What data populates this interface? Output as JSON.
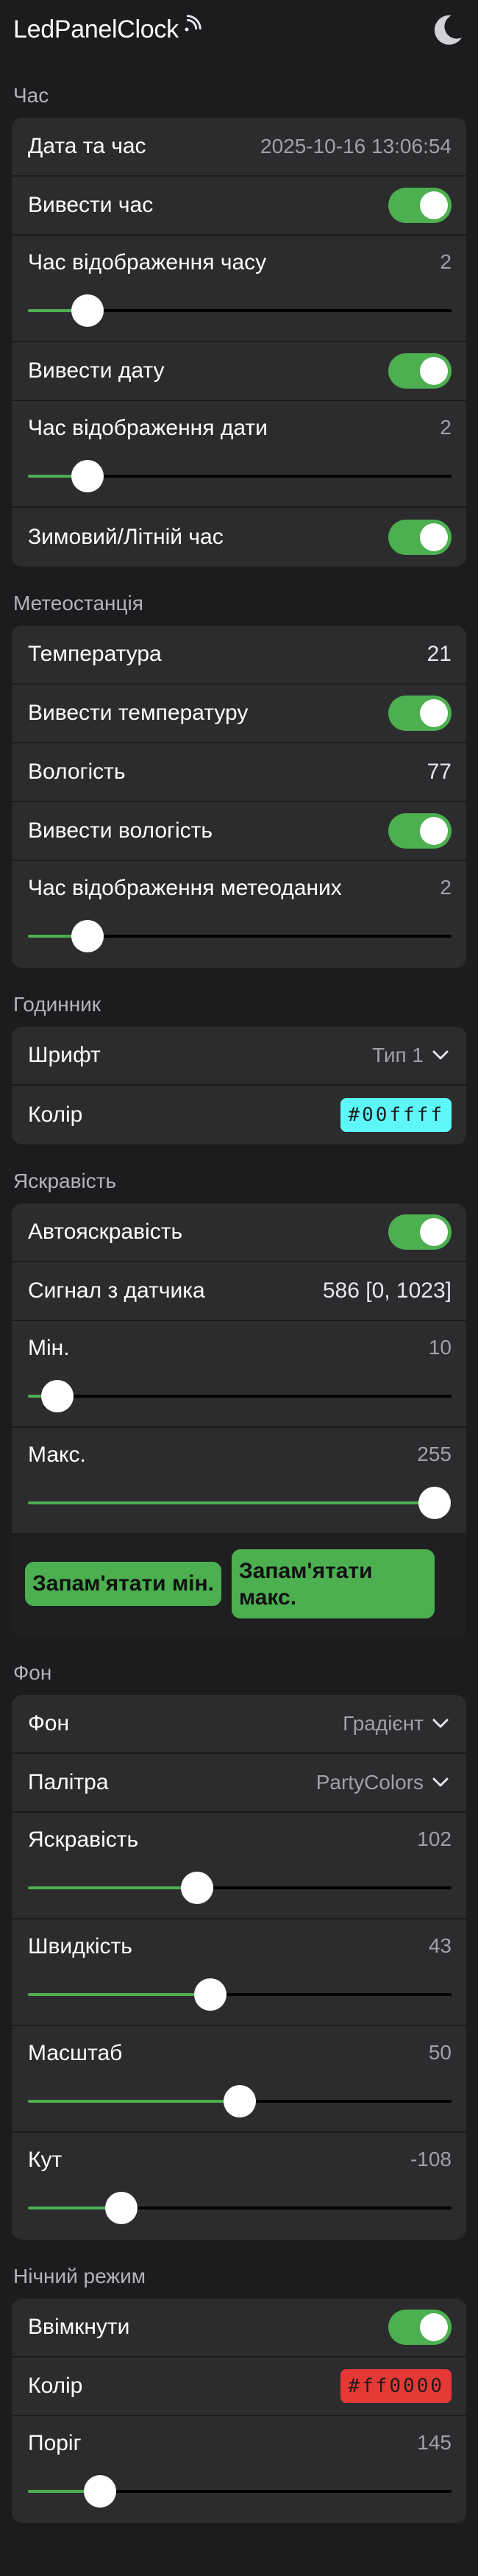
{
  "app": {
    "title": "LedPanelClock",
    "wifi_icon": "wifi-icon",
    "theme_icon": "moon-icon",
    "accent": "#4caf50"
  },
  "time": {
    "title": "Час",
    "datetime_label": "Дата та час",
    "datetime_value": "2025-10-16 13:06:54",
    "show_time_label": "Вивести час",
    "show_time_on": true,
    "time_duration_label": "Час відображення часу",
    "time_duration_value": "2",
    "time_duration_fraction": 0.14,
    "show_date_label": "Вивести дату",
    "show_date_on": true,
    "date_duration_label": "Час відображення дати",
    "date_duration_value": "2",
    "date_duration_fraction": 0.14,
    "dst_label": "Зимовий/Літній час",
    "dst_on": true
  },
  "weather": {
    "title": "Метеостанція",
    "temperature_label": "Температура",
    "temperature_value": "21",
    "show_temperature_label": "Вивести температуру",
    "show_temperature_on": true,
    "humidity_label": "Вологість",
    "humidity_value": "77",
    "show_humidity_label": "Вивести вологість",
    "show_humidity_on": true,
    "meteo_duration_label": "Час відображення метеоданих",
    "meteo_duration_value": "2",
    "meteo_duration_fraction": 0.14
  },
  "clock": {
    "title": "Годинник",
    "font_label": "Шрифт",
    "font_value": "Тип 1",
    "color_label": "Колір",
    "color_value": "#00ffff",
    "color_hex": "#5ef7f7"
  },
  "brightness": {
    "title": "Яскравість",
    "auto_label": "Автояскравість",
    "auto_on": true,
    "sensor_label": "Сигнал з датчика",
    "sensor_value": "586 [0, 1023]",
    "min_label": "Мін.",
    "min_value": "10",
    "min_fraction": 0.07,
    "max_label": "Макс.",
    "max_value": "255",
    "max_fraction": 0.96,
    "remember_min_label": "Запам'ятати мін.",
    "remember_max_label": "Запам'ятати макс."
  },
  "background": {
    "title": "Фон",
    "bg_label": "Фон",
    "bg_value": "Градієнт",
    "palette_label": "Палітра",
    "palette_value": "PartyColors",
    "brightness_label": "Яскравість",
    "brightness_value": "102",
    "brightness_fraction": 0.4,
    "speed_label": "Швидкість",
    "speed_value": "43",
    "speed_fraction": 0.43,
    "scale_label": "Масштаб",
    "scale_value": "50",
    "scale_fraction": 0.5,
    "angle_label": "Кут",
    "angle_value": "-108",
    "angle_fraction": 0.22
  },
  "night": {
    "title": "Нічний режим",
    "enable_label": "Ввімкнути",
    "enable_on": true,
    "color_label": "Колір",
    "color_value": "#ff0000",
    "color_hex": "#e53935",
    "threshold_label": "Поріг",
    "threshold_value": "145",
    "threshold_fraction": 0.17
  }
}
